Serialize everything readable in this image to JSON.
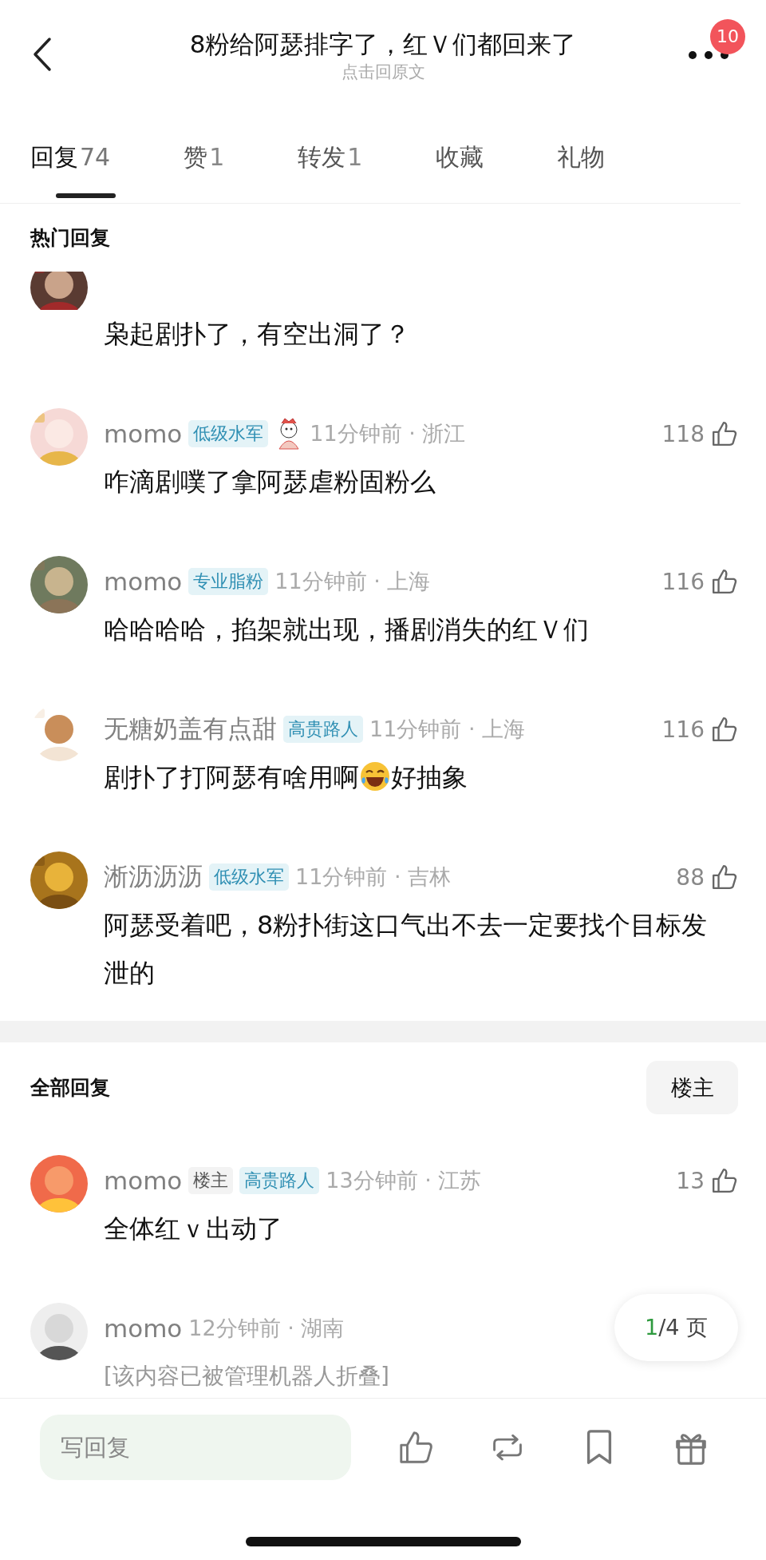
{
  "header": {
    "title": "8粉给阿瑟排字了，红Ｖ们都回来了",
    "subtitle": "点击回原文",
    "notification_count": "10"
  },
  "tabs": [
    {
      "label": "回复",
      "count": "74",
      "selected": true
    },
    {
      "label": "赞",
      "count": "1",
      "selected": false
    },
    {
      "label": "转发",
      "count": "1",
      "selected": false
    },
    {
      "label": "收藏",
      "selected": false
    },
    {
      "label": "礼物",
      "selected": false
    }
  ],
  "hot_replies": {
    "title": "热门回复",
    "comments": [
      {
        "partial": true,
        "collapsed": false,
        "body": [
          {
            "kind": "text",
            "text": "枭起剧扑了，有空出洞了？"
          }
        ]
      },
      {
        "partial": false,
        "name": "momo",
        "badges": [
          {
            "kind": "level",
            "text": "低级水军"
          }
        ],
        "sticker": true,
        "meta": "11分钟前 · 浙江",
        "likes": "118",
        "collapsed": false,
        "body": [
          {
            "kind": "text",
            "text": "咋滴剧噗了拿阿瑟虐粉固粉么"
          }
        ]
      },
      {
        "partial": false,
        "name": "momo",
        "badges": [
          {
            "kind": "level",
            "text": "专业脂粉"
          }
        ],
        "sticker": false,
        "meta": "11分钟前 · 上海",
        "likes": "116",
        "collapsed": false,
        "body": [
          {
            "kind": "text",
            "text": "哈哈哈哈，掐架就出现，播剧消失的红Ｖ们"
          }
        ]
      },
      {
        "partial": false,
        "name": "无糖奶盖有点甜",
        "badges": [
          {
            "kind": "level",
            "text": "高贵路人"
          }
        ],
        "sticker": false,
        "meta": "11分钟前 · 上海",
        "likes": "116",
        "collapsed": false,
        "body": [
          {
            "kind": "text",
            "text": "剧扑了打阿瑟有啥用啊"
          },
          {
            "kind": "emoji"
          },
          {
            "kind": "text",
            "text": "好抽象"
          }
        ]
      },
      {
        "partial": false,
        "name": "淅沥沥沥",
        "badges": [
          {
            "kind": "level",
            "text": "低级水军"
          }
        ],
        "sticker": false,
        "meta": "11分钟前 · 吉林",
        "likes": "88",
        "collapsed": false,
        "body": [
          {
            "kind": "text",
            "text": "阿瑟受着吧，8粉扑街这口气出不去一定要找个目标发泄的"
          }
        ]
      }
    ]
  },
  "all_replies": {
    "title": "全部回复",
    "filter_button": "楼主",
    "comments": [
      {
        "name": "momo",
        "badges": [
          {
            "kind": "op",
            "text": "楼主"
          },
          {
            "kind": "level",
            "text": "高贵路人"
          }
        ],
        "meta": "13分钟前 · 江苏",
        "likes": "13",
        "collapsed": false,
        "body": [
          {
            "kind": "text",
            "text": "全体红ｖ出动了"
          }
        ]
      },
      {
        "name": "momo",
        "meta": "12分钟前 · 湖南",
        "collapsed": true,
        "body": [
          {
            "kind": "text",
            "text": "[该内容已被管理机器人折叠]"
          }
        ]
      }
    ]
  },
  "pager": {
    "current": "1",
    "total": "/4",
    "unit": "页"
  },
  "reply_bar": {
    "placeholder": "写回复"
  }
}
